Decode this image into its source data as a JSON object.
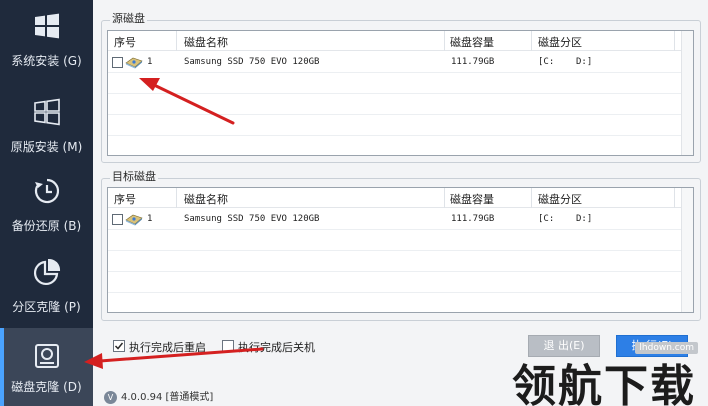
{
  "sidebar": {
    "items": [
      {
        "label": "系统安装 (G)",
        "icon": "windows-icon",
        "active": false
      },
      {
        "label": "原版安装 (M)",
        "icon": "windows-icon",
        "active": false
      },
      {
        "label": "备份还原 (B)",
        "icon": "clock-icon",
        "active": false
      },
      {
        "label": "分区克隆 (P)",
        "icon": "pie-chart-icon",
        "active": false
      },
      {
        "label": "磁盘克隆 (D)",
        "icon": "disk-icon",
        "active": true
      }
    ]
  },
  "source": {
    "title": "源磁盘",
    "columns": [
      "序号",
      "磁盘名称",
      "磁盘容量",
      "磁盘分区"
    ],
    "rows": [
      {
        "index": "1",
        "name": "Samsung SSD 750 EVO 120GB",
        "capacity": "111.79GB",
        "part1": "[C:",
        "part2": "D:]"
      }
    ]
  },
  "target": {
    "title": "目标磁盘",
    "columns": [
      "序号",
      "磁盘名称",
      "磁盘容量",
      "磁盘分区"
    ],
    "rows": [
      {
        "index": "1",
        "name": "Samsung SSD 750 EVO 120GB",
        "capacity": "111.79GB",
        "part1": "[C:",
        "part2": "D:]"
      }
    ]
  },
  "options": {
    "restart_label": "执行完成后重启",
    "restart_checked": true,
    "shutdown_label": "执行完成后关机",
    "shutdown_checked": false
  },
  "buttons": {
    "exit_label": "退 出(E)",
    "run_label": "执 行(E)"
  },
  "version": {
    "badge": "V",
    "text": "4.0.0.94 [普通模式]"
  },
  "watermark": {
    "text": "领航下载",
    "url": "lhdown.com"
  },
  "colors": {
    "sidebar_bg": "#1f2a3c",
    "sidebar_active": "#3b4658",
    "run_button": "#2d7fe6",
    "exit_button": "#b9bec5",
    "annotation_arrow": "#d42020"
  }
}
